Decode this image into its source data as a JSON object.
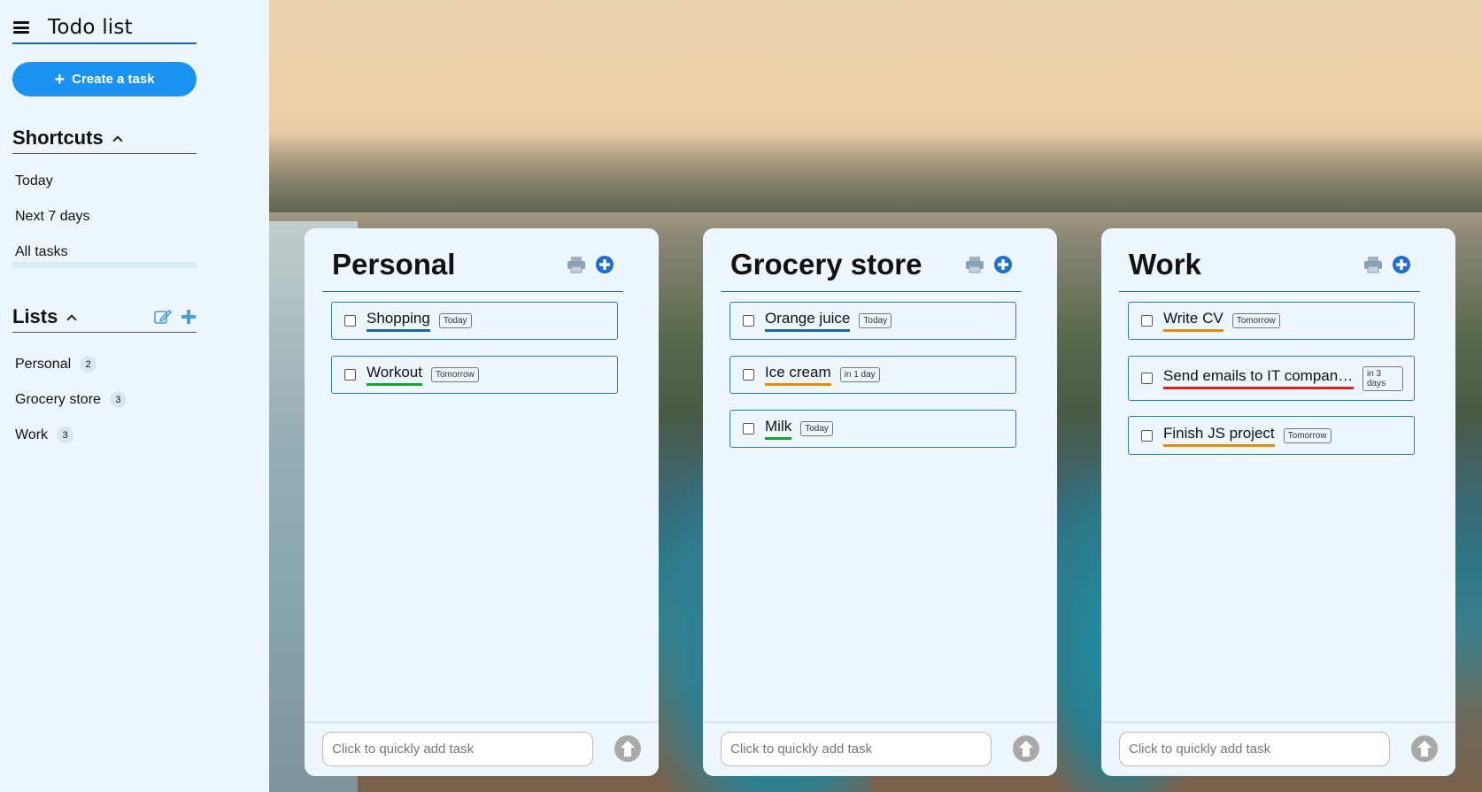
{
  "app": {
    "title": "Todo list",
    "create_label": "Create a task"
  },
  "shortcuts": {
    "title": "Shortcuts",
    "items": [
      {
        "label": "Today"
      },
      {
        "label": "Next 7 days"
      },
      {
        "label": "All tasks"
      }
    ]
  },
  "lists_nav": {
    "title": "Lists",
    "items": [
      {
        "label": "Personal",
        "count": "2"
      },
      {
        "label": "Grocery store",
        "count": "3"
      },
      {
        "label": "Work",
        "count": "3"
      }
    ]
  },
  "columns": [
    {
      "title": "Personal",
      "tasks": [
        {
          "name": "Shopping",
          "due": "Today",
          "color": "#1b6aa8"
        },
        {
          "name": "Workout",
          "due": "Tomorrow",
          "color": "#1aa32c"
        }
      ],
      "quick_add_placeholder": "Click to quickly add task"
    },
    {
      "title": "Grocery store",
      "tasks": [
        {
          "name": "Orange juice",
          "due": "Today",
          "color": "#1b6aa8"
        },
        {
          "name": "Ice cream",
          "due": "in 1 day",
          "color": "#e28b12"
        },
        {
          "name": "Milk",
          "due": "Today",
          "color": "#1aa32c"
        }
      ],
      "quick_add_placeholder": "Click to quickly add task"
    },
    {
      "title": "Work",
      "tasks": [
        {
          "name": "Write CV",
          "due": "Tomorrow",
          "color": "#e28b12"
        },
        {
          "name": "Send emails to IT compani...",
          "due": "in 3 days",
          "color": "#e01f1f"
        },
        {
          "name": "Finish JS project",
          "due": "Tomorrow",
          "color": "#e28b12"
        }
      ],
      "quick_add_placeholder": "Click to quickly add task"
    }
  ],
  "icons": {
    "menu": "hamburger-icon",
    "create": "plus-icon",
    "collapse": "chevron-up-icon",
    "edit": "edit-icon",
    "add": "plus-icon",
    "print": "printer-icon",
    "add_task": "plus-circle-icon",
    "submit": "arrow-up-circle-icon"
  },
  "colors": {
    "accent": "#1a93f0",
    "underline_blue": "#1b6aa8",
    "priority_low": "#1aa32c",
    "priority_medium": "#e28b12",
    "priority_high": "#e01f1f"
  }
}
